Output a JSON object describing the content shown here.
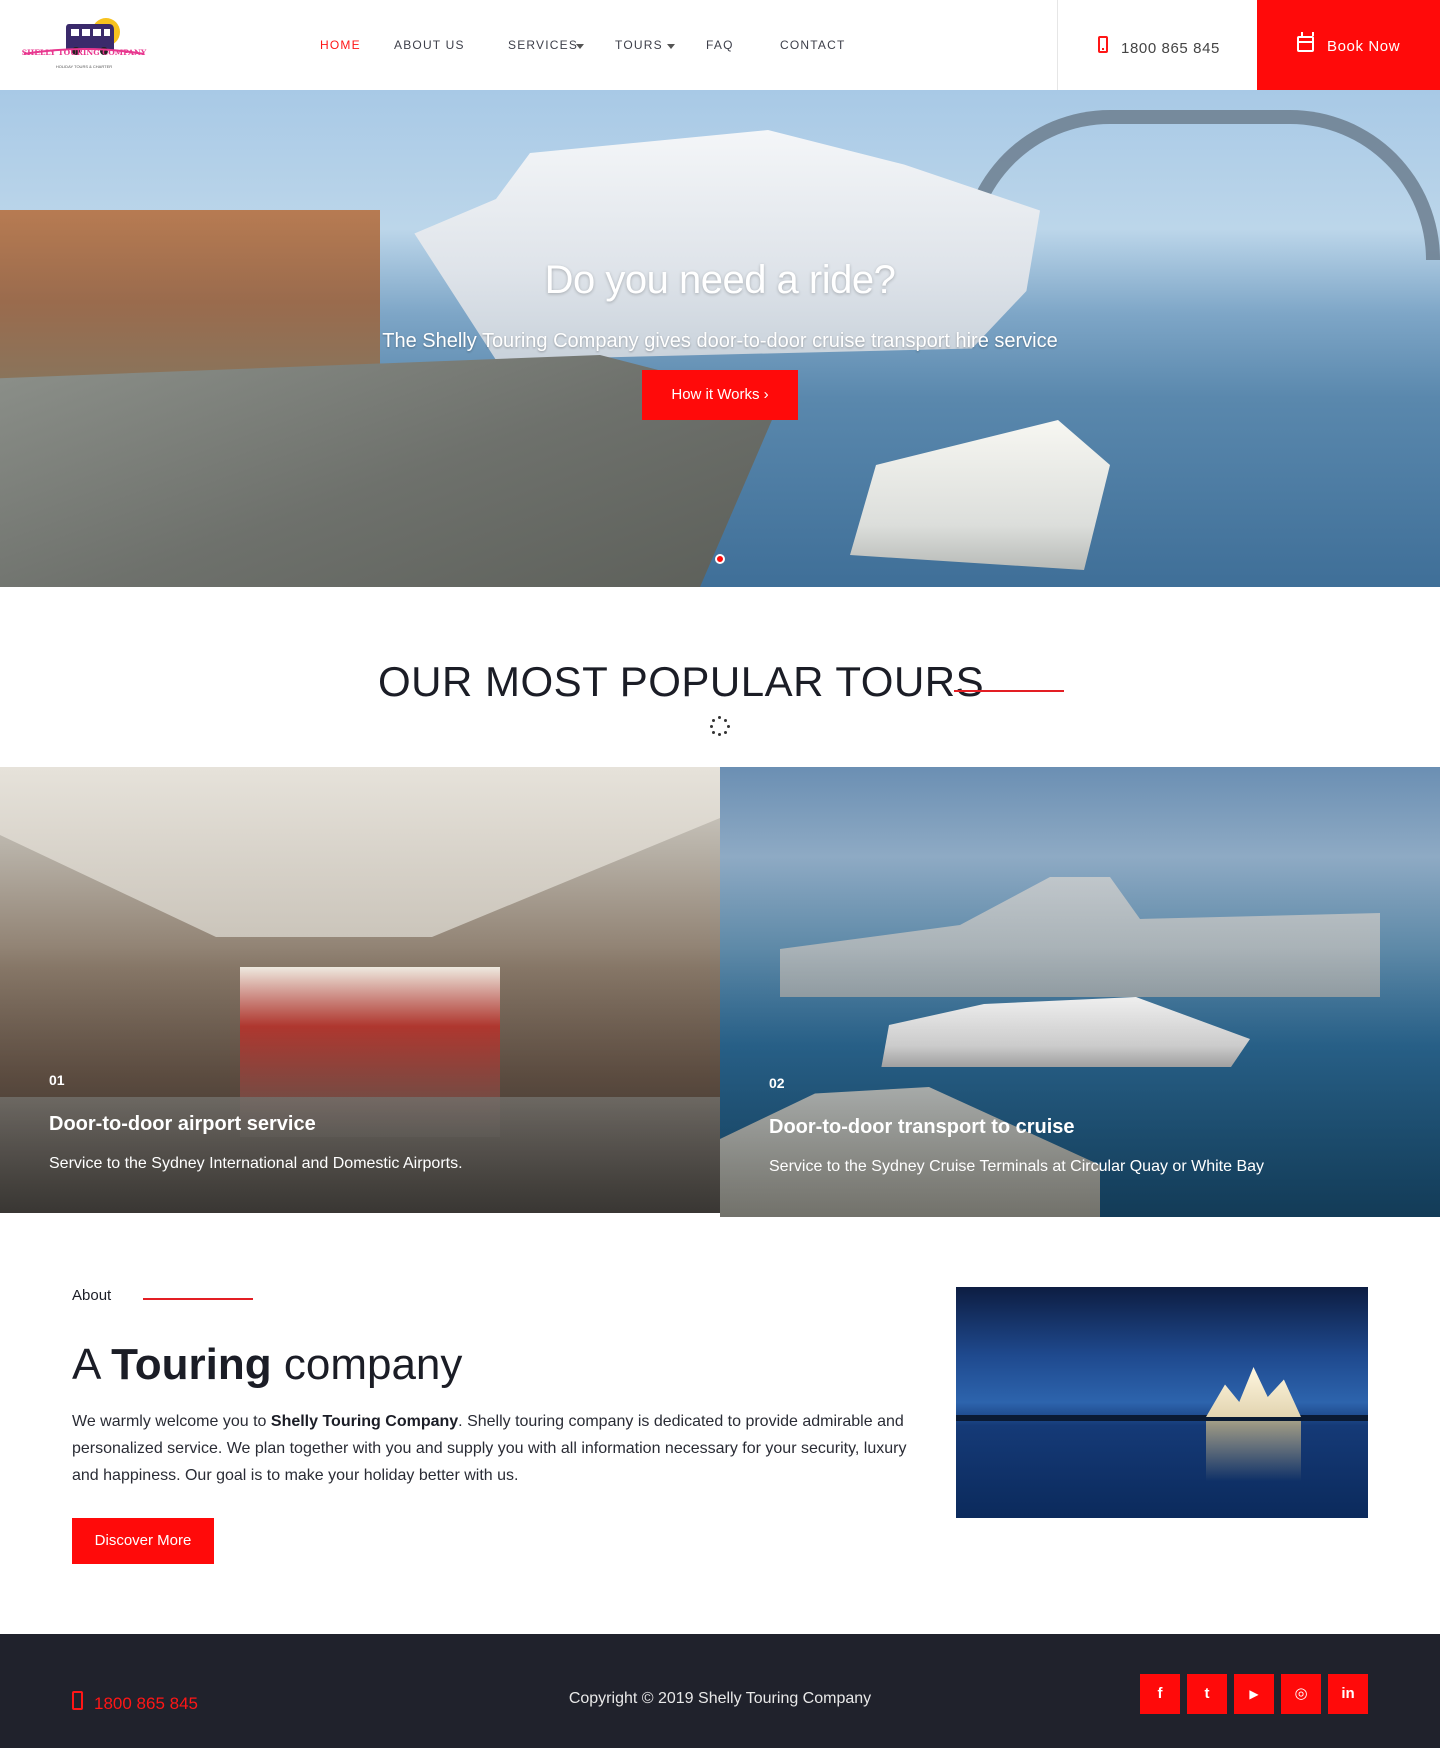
{
  "header": {
    "logo_text": "SHELLY TOURING COMPANY",
    "logo_tagline": "HOLIDAY TOURS & CHARTER",
    "nav": [
      {
        "label": "HOME",
        "active": true
      },
      {
        "label": "ABOUT US",
        "active": false
      },
      {
        "label": "SERVICES",
        "active": false,
        "dropdown": true
      },
      {
        "label": "TOURS",
        "active": false,
        "dropdown": true
      },
      {
        "label": "FAQ",
        "active": false
      },
      {
        "label": "CONTACT",
        "active": false
      }
    ],
    "phone": "1800 865 845",
    "book_label": "Book Now"
  },
  "hero": {
    "title": "Do you need a ride?",
    "subtitle": "The Shelly Touring Company gives door-to-door cruise transport hire service",
    "button_label": "How it Works",
    "button_icon": "chevron-right-icon"
  },
  "tours": {
    "title": "OUR MOST POPULAR TOURS",
    "cards": [
      {
        "number": "01",
        "title": "Door-to-door airport service",
        "description": "Service to the Sydney International and Domestic Airports."
      },
      {
        "number": "02",
        "title": "Door-to-door transport to cruise",
        "description": "Service to the Sydney Cruise Terminals at Circular Quay or White Bay"
      }
    ]
  },
  "about": {
    "kicker": "About",
    "title_pre": "A",
    "title_bold": "Touring",
    "title_post": "company",
    "text_pre": "We warmly welcome you to",
    "text_bold": "Shelly Touring Company",
    "text_post": ". Shelly touring company is dedicated to provide admirable and personalized service. We plan together with you and supply you with all information necessary for your security, luxury and happiness. Our goal is to make your holiday better with us.",
    "button_label": "Discover More"
  },
  "footer": {
    "phone": "1800 865 845",
    "copyright": "Copyright © 2019 Shelly Touring Company",
    "social": [
      {
        "name": "facebook-icon",
        "glyph": "f"
      },
      {
        "name": "twitter-icon",
        "glyph": "t"
      },
      {
        "name": "youtube-icon",
        "glyph": "▶"
      },
      {
        "name": "instagram-icon",
        "glyph": "◎"
      },
      {
        "name": "linkedin-icon",
        "glyph": "in"
      }
    ]
  },
  "colors": {
    "accent": "#ff0a0a",
    "dark": "#20222c"
  }
}
